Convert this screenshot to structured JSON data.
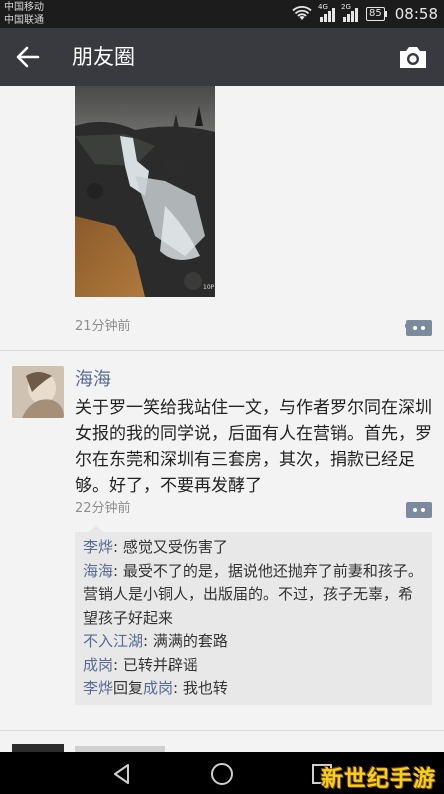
{
  "status_bar": {
    "carrier_1": "中国移动",
    "carrier_2": "中国联通",
    "net_tag_1": "4G",
    "net_tag_2": "2G",
    "battery": "85",
    "time": "08:58"
  },
  "header": {
    "title": "朋友圈",
    "back_icon": "arrow-left-icon",
    "camera_icon": "camera-icon"
  },
  "posts": [
    {
      "time": "21分钟前",
      "image_caption": "10P"
    },
    {
      "author": "海海",
      "text": "关于罗一笑给我站住一文，与作者罗尔同在深圳女报的我的同学说，后面有人在营销。首先，罗尔在东莞和深圳有三套房，其次，捐款已经足够。好了，不要再发酵了",
      "time": "22分钟前",
      "comments": [
        {
          "who": "李烨",
          "sep": ": ",
          "text": "感觉又受伤害了"
        },
        {
          "who": "海海",
          "sep": ": ",
          "text": "最受不了的是，据说他还抛弃了前妻和孩子。营销人是小铜人，出版届的。不过，孩子无辜，希望孩子好起来"
        },
        {
          "who": "不入江湖",
          "sep": ": ",
          "text": "满满的套路"
        },
        {
          "who": "成岗",
          "sep": ": ",
          "text": "已转并辟谣"
        },
        {
          "who": "李烨",
          "reply_word": "回复",
          "reply_to": "成岗",
          "sep": ": ",
          "text": "我也转"
        }
      ]
    }
  ],
  "nav": {
    "back_icon": "triangle-back-icon",
    "home_icon": "circle-home-icon",
    "recents_icon": "square-recents-icon"
  },
  "watermark": "新世纪手游",
  "colors": {
    "title_bar": "#393a3f",
    "link_blue": "#576b95",
    "comment_bg": "#e8e8e8"
  }
}
